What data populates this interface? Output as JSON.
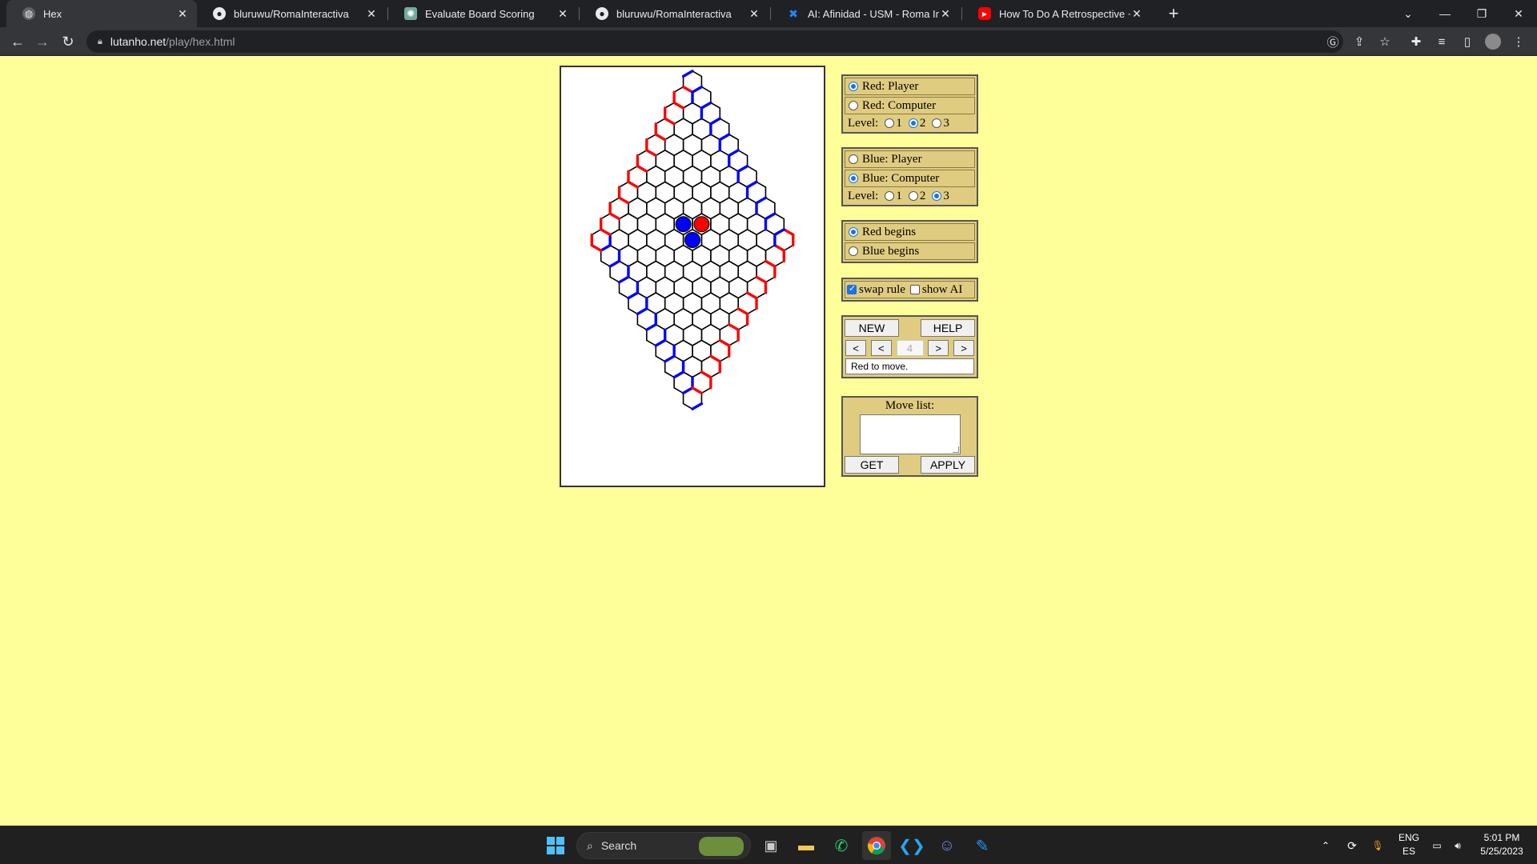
{
  "browser": {
    "tabs": [
      {
        "title": "Hex",
        "icon": "globe-icon",
        "active": true
      },
      {
        "title": "bluruwu/RomaInteractiva",
        "icon": "github-icon",
        "active": false
      },
      {
        "title": "Evaluate Board Scoring",
        "icon": "chatgpt-icon",
        "active": false
      },
      {
        "title": "bluruwu/RomaInteractiva",
        "icon": "github-icon",
        "active": false
      },
      {
        "title": "AI: Afinidad - USM - Roma Intera",
        "icon": "jira-icon",
        "active": false
      },
      {
        "title": "How To Do A Retrospective + (St",
        "icon": "youtube-icon",
        "active": false
      }
    ],
    "url_host": "lutanho.net",
    "url_path": "/play/hex.html"
  },
  "game": {
    "board": {
      "size": 11,
      "border_colors": {
        "red": "#ff0000",
        "blue": "#0000ff"
      },
      "stones": [
        {
          "color": "blue",
          "row": 5,
          "col": 4
        },
        {
          "color": "red",
          "row": 4,
          "col": 5
        },
        {
          "color": "blue",
          "row": 5,
          "col": 5
        }
      ]
    },
    "red_player_label": "Red: Player",
    "red_computer_label": "Red: Computer",
    "red_mode": "player",
    "red_level": 2,
    "blue_player_label": "Blue: Player",
    "blue_computer_label": "Blue: Computer",
    "blue_mode": "computer",
    "blue_level": 3,
    "level_label": "Level:",
    "levels": [
      "1",
      "2",
      "3"
    ],
    "red_begins_label": "Red begins",
    "blue_begins_label": "Blue begins",
    "begins": "red",
    "swap_rule_label": "swap rule",
    "swap_rule_checked": true,
    "show_ai_label": "show AI",
    "show_ai_checked": false,
    "new_label": "NEW",
    "help_label": "HELP",
    "nav_first": "<",
    "nav_prev": "<",
    "move_number": "4",
    "nav_next": ">",
    "nav_last": ">",
    "status_text": "Red to move.",
    "move_list_label": "Move list:",
    "get_label": "GET",
    "apply_label": "APPLY"
  },
  "taskbar": {
    "search_label": "Search",
    "lang_line1": "ENG",
    "lang_line2": "ES",
    "time": "5:01 PM",
    "date": "5/25/2023"
  }
}
